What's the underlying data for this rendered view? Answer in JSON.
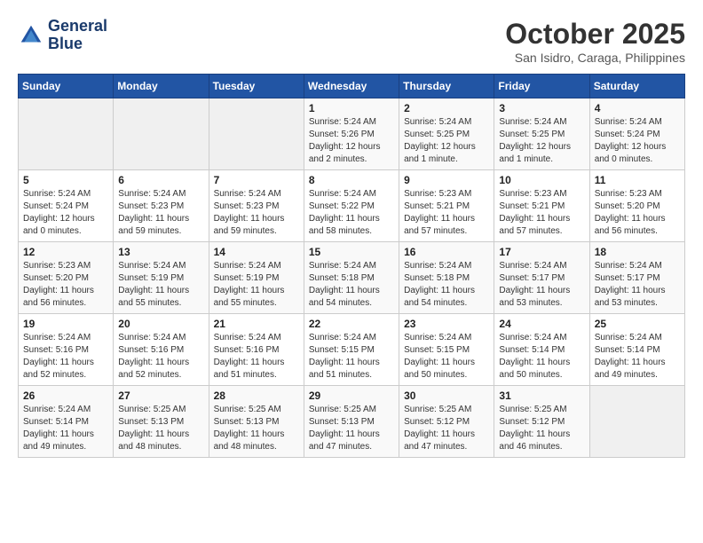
{
  "header": {
    "logo_line1": "General",
    "logo_line2": "Blue",
    "month": "October 2025",
    "location": "San Isidro, Caraga, Philippines"
  },
  "weekdays": [
    "Sunday",
    "Monday",
    "Tuesday",
    "Wednesday",
    "Thursday",
    "Friday",
    "Saturday"
  ],
  "weeks": [
    [
      {
        "day": "",
        "info": ""
      },
      {
        "day": "",
        "info": ""
      },
      {
        "day": "",
        "info": ""
      },
      {
        "day": "1",
        "info": "Sunrise: 5:24 AM\nSunset: 5:26 PM\nDaylight: 12 hours\nand 2 minutes."
      },
      {
        "day": "2",
        "info": "Sunrise: 5:24 AM\nSunset: 5:25 PM\nDaylight: 12 hours\nand 1 minute."
      },
      {
        "day": "3",
        "info": "Sunrise: 5:24 AM\nSunset: 5:25 PM\nDaylight: 12 hours\nand 1 minute."
      },
      {
        "day": "4",
        "info": "Sunrise: 5:24 AM\nSunset: 5:24 PM\nDaylight: 12 hours\nand 0 minutes."
      }
    ],
    [
      {
        "day": "5",
        "info": "Sunrise: 5:24 AM\nSunset: 5:24 PM\nDaylight: 12 hours\nand 0 minutes."
      },
      {
        "day": "6",
        "info": "Sunrise: 5:24 AM\nSunset: 5:23 PM\nDaylight: 11 hours\nand 59 minutes."
      },
      {
        "day": "7",
        "info": "Sunrise: 5:24 AM\nSunset: 5:23 PM\nDaylight: 11 hours\nand 59 minutes."
      },
      {
        "day": "8",
        "info": "Sunrise: 5:24 AM\nSunset: 5:22 PM\nDaylight: 11 hours\nand 58 minutes."
      },
      {
        "day": "9",
        "info": "Sunrise: 5:23 AM\nSunset: 5:21 PM\nDaylight: 11 hours\nand 57 minutes."
      },
      {
        "day": "10",
        "info": "Sunrise: 5:23 AM\nSunset: 5:21 PM\nDaylight: 11 hours\nand 57 minutes."
      },
      {
        "day": "11",
        "info": "Sunrise: 5:23 AM\nSunset: 5:20 PM\nDaylight: 11 hours\nand 56 minutes."
      }
    ],
    [
      {
        "day": "12",
        "info": "Sunrise: 5:23 AM\nSunset: 5:20 PM\nDaylight: 11 hours\nand 56 minutes."
      },
      {
        "day": "13",
        "info": "Sunrise: 5:24 AM\nSunset: 5:19 PM\nDaylight: 11 hours\nand 55 minutes."
      },
      {
        "day": "14",
        "info": "Sunrise: 5:24 AM\nSunset: 5:19 PM\nDaylight: 11 hours\nand 55 minutes."
      },
      {
        "day": "15",
        "info": "Sunrise: 5:24 AM\nSunset: 5:18 PM\nDaylight: 11 hours\nand 54 minutes."
      },
      {
        "day": "16",
        "info": "Sunrise: 5:24 AM\nSunset: 5:18 PM\nDaylight: 11 hours\nand 54 minutes."
      },
      {
        "day": "17",
        "info": "Sunrise: 5:24 AM\nSunset: 5:17 PM\nDaylight: 11 hours\nand 53 minutes."
      },
      {
        "day": "18",
        "info": "Sunrise: 5:24 AM\nSunset: 5:17 PM\nDaylight: 11 hours\nand 53 minutes."
      }
    ],
    [
      {
        "day": "19",
        "info": "Sunrise: 5:24 AM\nSunset: 5:16 PM\nDaylight: 11 hours\nand 52 minutes."
      },
      {
        "day": "20",
        "info": "Sunrise: 5:24 AM\nSunset: 5:16 PM\nDaylight: 11 hours\nand 52 minutes."
      },
      {
        "day": "21",
        "info": "Sunrise: 5:24 AM\nSunset: 5:16 PM\nDaylight: 11 hours\nand 51 minutes."
      },
      {
        "day": "22",
        "info": "Sunrise: 5:24 AM\nSunset: 5:15 PM\nDaylight: 11 hours\nand 51 minutes."
      },
      {
        "day": "23",
        "info": "Sunrise: 5:24 AM\nSunset: 5:15 PM\nDaylight: 11 hours\nand 50 minutes."
      },
      {
        "day": "24",
        "info": "Sunrise: 5:24 AM\nSunset: 5:14 PM\nDaylight: 11 hours\nand 50 minutes."
      },
      {
        "day": "25",
        "info": "Sunrise: 5:24 AM\nSunset: 5:14 PM\nDaylight: 11 hours\nand 49 minutes."
      }
    ],
    [
      {
        "day": "26",
        "info": "Sunrise: 5:24 AM\nSunset: 5:14 PM\nDaylight: 11 hours\nand 49 minutes."
      },
      {
        "day": "27",
        "info": "Sunrise: 5:25 AM\nSunset: 5:13 PM\nDaylight: 11 hours\nand 48 minutes."
      },
      {
        "day": "28",
        "info": "Sunrise: 5:25 AM\nSunset: 5:13 PM\nDaylight: 11 hours\nand 48 minutes."
      },
      {
        "day": "29",
        "info": "Sunrise: 5:25 AM\nSunset: 5:13 PM\nDaylight: 11 hours\nand 47 minutes."
      },
      {
        "day": "30",
        "info": "Sunrise: 5:25 AM\nSunset: 5:12 PM\nDaylight: 11 hours\nand 47 minutes."
      },
      {
        "day": "31",
        "info": "Sunrise: 5:25 AM\nSunset: 5:12 PM\nDaylight: 11 hours\nand 46 minutes."
      },
      {
        "day": "",
        "info": ""
      }
    ]
  ]
}
